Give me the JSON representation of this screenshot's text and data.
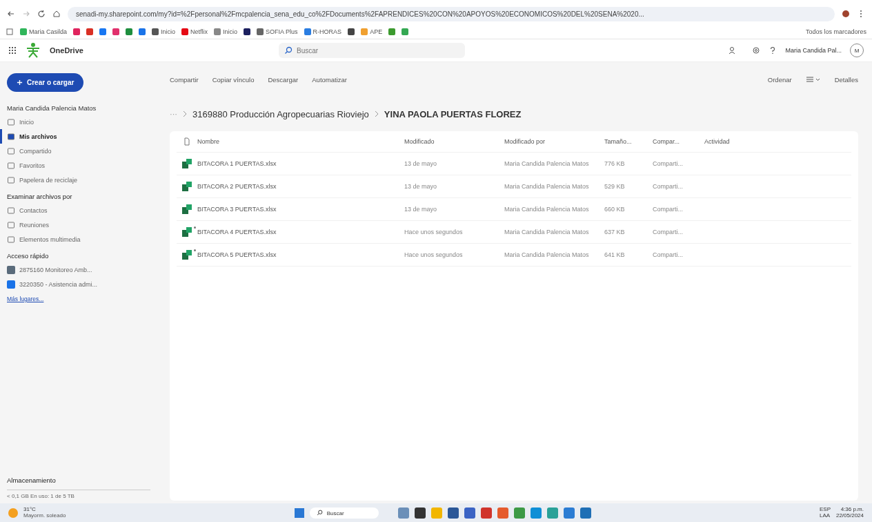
{
  "browser": {
    "url": "senadi-my.sharepoint.com/my?id=%2Fpersonal%2Fmcpalencia_sena_edu_co%2FDocuments%2FAPRENDICES%20CON%20APOYOS%20ECONOMICOS%20DEL%20SENA%2020...",
    "bookmarks": [
      {
        "label": "Maria Casilda",
        "color": "#2fb55a"
      },
      {
        "color": "#e0245e"
      },
      {
        "color": "#d93025"
      },
      {
        "color": "#1877f2"
      },
      {
        "color": "#e1306c"
      },
      {
        "color": "#1e8e3e"
      },
      {
        "color": "#1a73e8"
      },
      {
        "label": "Inicio",
        "color": "#555555"
      },
      {
        "label": "Netflix",
        "color": "#e50914"
      },
      {
        "label": "Inicio",
        "color": "#888888"
      },
      {
        "color": "#1b1f5e"
      },
      {
        "label": "SOFIA Plus",
        "color": "#666666"
      },
      {
        "label": "R-HORAS",
        "color": "#2a7de1"
      },
      {
        "color": "#444444"
      },
      {
        "label": "APE",
        "color": "#f0a030"
      },
      {
        "color": "#3c9a2e"
      },
      {
        "color": "#34a853"
      }
    ],
    "all_bookmarks": "Todos los marcadores"
  },
  "app": {
    "name": "OneDrive",
    "search_placeholder": "Buscar",
    "user": "Maria Candida Pal...",
    "avatar": "M"
  },
  "sidebar": {
    "create_button": "Crear o cargar",
    "owner": "Maria Candida Palencia Matos",
    "items": [
      {
        "label": "Inicio",
        "selected": false
      },
      {
        "label": "Mis archivos",
        "selected": true
      },
      {
        "label": "Compartido",
        "selected": false
      },
      {
        "label": "Favoritos",
        "selected": false
      },
      {
        "label": "Papelera de reciclaje",
        "selected": false
      }
    ],
    "browse_heading": "Examinar archivos por",
    "browse_items": [
      {
        "label": "Contactos"
      },
      {
        "label": "Reuniones"
      },
      {
        "label": "Elementos multimedia"
      }
    ],
    "quick_heading": "Acceso rápido",
    "quick_items": [
      {
        "label": "2875160 Monitoreo Amb...",
        "color": "#5a6b7b"
      },
      {
        "label": "3220350 - Asistencia admi...",
        "color": "#1a73e8"
      }
    ],
    "more_places": "Más lugares...",
    "storage_heading": "Almacenamiento",
    "storage_text": "< 0,1 GB En uso: 1 de 5 TB"
  },
  "toolbar": {
    "actions": [
      "Compartir",
      "Copiar vínculo",
      "Descargar",
      "Automatizar"
    ],
    "sort": "Ordenar",
    "details": "Detalles"
  },
  "breadcrumb": {
    "ellipsis": "···",
    "items": [
      "3169880 Producción Agropecuarias Rioviejo",
      "YINA PAOLA PUERTAS FLOREZ"
    ]
  },
  "table": {
    "columns": [
      "Nombre",
      "Modificado",
      "Modificado por",
      "Tamaño...",
      "Compar...",
      "Actividad"
    ],
    "rows": [
      {
        "name": "BITACORA 1 PUERTAS.xlsx",
        "new": false,
        "modified": "13 de mayo",
        "modified_by": "Maria Candida Palencia Matos",
        "size": "776 KB",
        "sharing": "Comparti..."
      },
      {
        "name": "BITACORA 2 PUERTAS.xlsx",
        "new": false,
        "modified": "13 de mayo",
        "modified_by": "Maria Candida Palencia Matos",
        "size": "529 KB",
        "sharing": "Comparti..."
      },
      {
        "name": "BITACORA 3 PUERTAS.xlsx",
        "new": false,
        "modified": "13 de mayo",
        "modified_by": "Maria Candida Palencia Matos",
        "size": "660 KB",
        "sharing": "Comparti..."
      },
      {
        "name": "BITACORA 4 PUERTAS.xlsx",
        "new": true,
        "modified": "Hace unos segundos",
        "modified_by": "Maria Candida Palencia Matos",
        "size": "637 KB",
        "sharing": "Comparti..."
      },
      {
        "name": "BITACORA 5 PUERTAS.xlsx",
        "new": true,
        "modified": "Hace unos segundos",
        "modified_by": "Maria Candida Palencia Matos",
        "size": "641 KB",
        "sharing": "Comparti..."
      }
    ]
  },
  "taskbar": {
    "temperature": "31°C",
    "weather": "Mayorm. soleado",
    "search": "Buscar",
    "apps": [
      {
        "color": "#6b8fb8"
      },
      {
        "color": "#333333"
      },
      {
        "color": "#f2b600"
      },
      {
        "color": "#2b5797"
      },
      {
        "color": "#3b63c4"
      },
      {
        "color": "#d0342c"
      },
      {
        "color": "#e55b2d"
      },
      {
        "color": "#3d9a46"
      },
      {
        "color": "#0f8fd6"
      },
      {
        "color": "#2aa198"
      },
      {
        "color": "#2b7cd3"
      },
      {
        "color": "#1f6fb5"
      }
    ],
    "language": "ESP",
    "layout": "LAA",
    "time": "4:36 p.m.",
    "date": "22/05/2024"
  }
}
